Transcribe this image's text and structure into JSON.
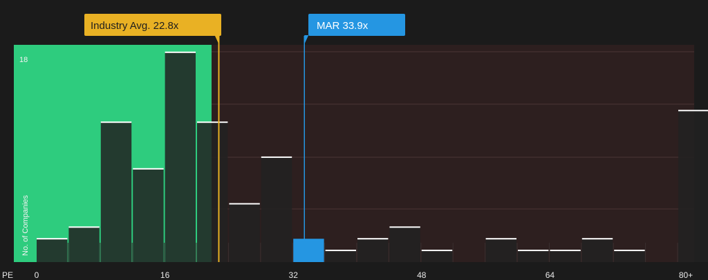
{
  "colors": {
    "background": "#1b1b1b",
    "green_zone": "#2ecc7e",
    "red_zone": "#2d1f1f",
    "industry_accent": "#e9b124",
    "company_accent": "#2596e2",
    "bar_dark": "#222222",
    "bar_top": "#ffffff"
  },
  "chart_data": {
    "type": "bar",
    "x_axis_label": "PE",
    "y_axis_label": "No. of Companies",
    "x_ticks": [
      "0",
      "16",
      "32",
      "48",
      "64",
      "80+"
    ],
    "y_tick_label": "18",
    "bin_width": 4,
    "bins": [
      {
        "start": 0,
        "count": 2
      },
      {
        "start": 4,
        "count": 3
      },
      {
        "start": 8,
        "count": 12
      },
      {
        "start": 12,
        "count": 8
      },
      {
        "start": 16,
        "count": 18
      },
      {
        "start": 20,
        "count": 12
      },
      {
        "start": 24,
        "count": 5
      },
      {
        "start": 28,
        "count": 9
      },
      {
        "start": 32,
        "count": 2
      },
      {
        "start": 36,
        "count": 1
      },
      {
        "start": 40,
        "count": 2
      },
      {
        "start": 44,
        "count": 3
      },
      {
        "start": 48,
        "count": 1
      },
      {
        "start": 52,
        "count": 0
      },
      {
        "start": 56,
        "count": 2
      },
      {
        "start": 60,
        "count": 1
      },
      {
        "start": 64,
        "count": 1
      },
      {
        "start": 68,
        "count": 2
      },
      {
        "start": 72,
        "count": 1
      },
      {
        "start": 76,
        "count": 0
      },
      {
        "start": 80,
        "count": 13
      }
    ],
    "highlight_bin_start": 32,
    "industry_avg": {
      "label": "Industry Avg. 22.8x",
      "value": 22.8
    },
    "company": {
      "label": "MAR 33.9x",
      "value": 33.9
    },
    "ylim": [
      0,
      18.5
    ]
  }
}
